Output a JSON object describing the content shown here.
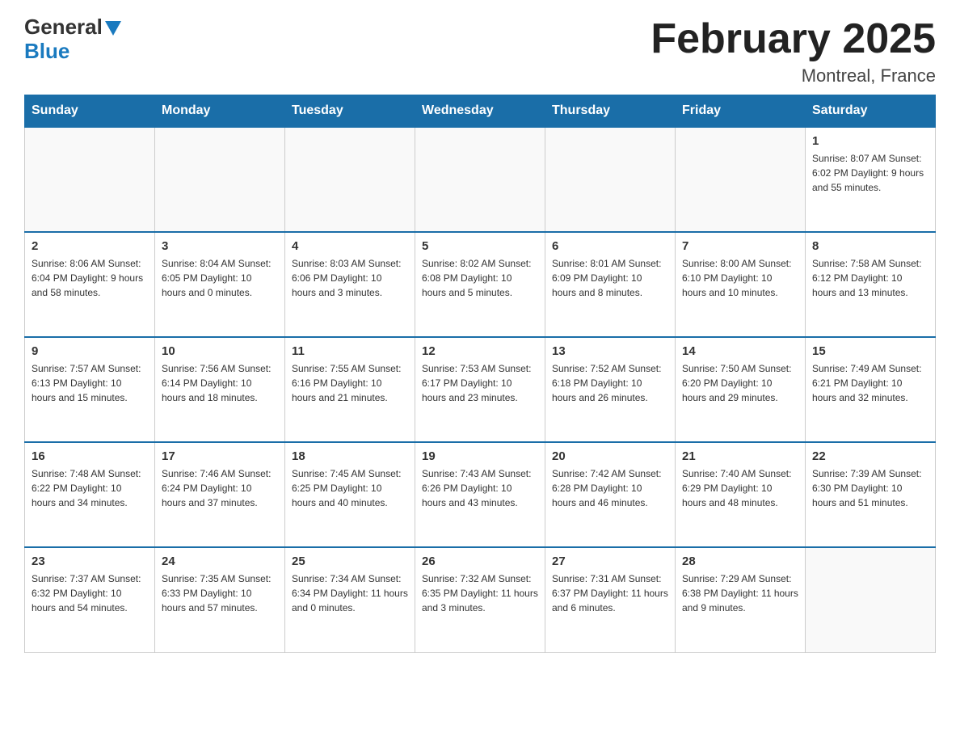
{
  "logo": {
    "text_general": "General",
    "text_blue": "Blue"
  },
  "header": {
    "title": "February 2025",
    "location": "Montreal, France"
  },
  "days_of_week": [
    "Sunday",
    "Monday",
    "Tuesday",
    "Wednesday",
    "Thursday",
    "Friday",
    "Saturday"
  ],
  "weeks": [
    [
      {
        "day": "",
        "info": ""
      },
      {
        "day": "",
        "info": ""
      },
      {
        "day": "",
        "info": ""
      },
      {
        "day": "",
        "info": ""
      },
      {
        "day": "",
        "info": ""
      },
      {
        "day": "",
        "info": ""
      },
      {
        "day": "1",
        "info": "Sunrise: 8:07 AM\nSunset: 6:02 PM\nDaylight: 9 hours and 55 minutes."
      }
    ],
    [
      {
        "day": "2",
        "info": "Sunrise: 8:06 AM\nSunset: 6:04 PM\nDaylight: 9 hours and 58 minutes."
      },
      {
        "day": "3",
        "info": "Sunrise: 8:04 AM\nSunset: 6:05 PM\nDaylight: 10 hours and 0 minutes."
      },
      {
        "day": "4",
        "info": "Sunrise: 8:03 AM\nSunset: 6:06 PM\nDaylight: 10 hours and 3 minutes."
      },
      {
        "day": "5",
        "info": "Sunrise: 8:02 AM\nSunset: 6:08 PM\nDaylight: 10 hours and 5 minutes."
      },
      {
        "day": "6",
        "info": "Sunrise: 8:01 AM\nSunset: 6:09 PM\nDaylight: 10 hours and 8 minutes."
      },
      {
        "day": "7",
        "info": "Sunrise: 8:00 AM\nSunset: 6:10 PM\nDaylight: 10 hours and 10 minutes."
      },
      {
        "day": "8",
        "info": "Sunrise: 7:58 AM\nSunset: 6:12 PM\nDaylight: 10 hours and 13 minutes."
      }
    ],
    [
      {
        "day": "9",
        "info": "Sunrise: 7:57 AM\nSunset: 6:13 PM\nDaylight: 10 hours and 15 minutes."
      },
      {
        "day": "10",
        "info": "Sunrise: 7:56 AM\nSunset: 6:14 PM\nDaylight: 10 hours and 18 minutes."
      },
      {
        "day": "11",
        "info": "Sunrise: 7:55 AM\nSunset: 6:16 PM\nDaylight: 10 hours and 21 minutes."
      },
      {
        "day": "12",
        "info": "Sunrise: 7:53 AM\nSunset: 6:17 PM\nDaylight: 10 hours and 23 minutes."
      },
      {
        "day": "13",
        "info": "Sunrise: 7:52 AM\nSunset: 6:18 PM\nDaylight: 10 hours and 26 minutes."
      },
      {
        "day": "14",
        "info": "Sunrise: 7:50 AM\nSunset: 6:20 PM\nDaylight: 10 hours and 29 minutes."
      },
      {
        "day": "15",
        "info": "Sunrise: 7:49 AM\nSunset: 6:21 PM\nDaylight: 10 hours and 32 minutes."
      }
    ],
    [
      {
        "day": "16",
        "info": "Sunrise: 7:48 AM\nSunset: 6:22 PM\nDaylight: 10 hours and 34 minutes."
      },
      {
        "day": "17",
        "info": "Sunrise: 7:46 AM\nSunset: 6:24 PM\nDaylight: 10 hours and 37 minutes."
      },
      {
        "day": "18",
        "info": "Sunrise: 7:45 AM\nSunset: 6:25 PM\nDaylight: 10 hours and 40 minutes."
      },
      {
        "day": "19",
        "info": "Sunrise: 7:43 AM\nSunset: 6:26 PM\nDaylight: 10 hours and 43 minutes."
      },
      {
        "day": "20",
        "info": "Sunrise: 7:42 AM\nSunset: 6:28 PM\nDaylight: 10 hours and 46 minutes."
      },
      {
        "day": "21",
        "info": "Sunrise: 7:40 AM\nSunset: 6:29 PM\nDaylight: 10 hours and 48 minutes."
      },
      {
        "day": "22",
        "info": "Sunrise: 7:39 AM\nSunset: 6:30 PM\nDaylight: 10 hours and 51 minutes."
      }
    ],
    [
      {
        "day": "23",
        "info": "Sunrise: 7:37 AM\nSunset: 6:32 PM\nDaylight: 10 hours and 54 minutes."
      },
      {
        "day": "24",
        "info": "Sunrise: 7:35 AM\nSunset: 6:33 PM\nDaylight: 10 hours and 57 minutes."
      },
      {
        "day": "25",
        "info": "Sunrise: 7:34 AM\nSunset: 6:34 PM\nDaylight: 11 hours and 0 minutes."
      },
      {
        "day": "26",
        "info": "Sunrise: 7:32 AM\nSunset: 6:35 PM\nDaylight: 11 hours and 3 minutes."
      },
      {
        "day": "27",
        "info": "Sunrise: 7:31 AM\nSunset: 6:37 PM\nDaylight: 11 hours and 6 minutes."
      },
      {
        "day": "28",
        "info": "Sunrise: 7:29 AM\nSunset: 6:38 PM\nDaylight: 11 hours and 9 minutes."
      },
      {
        "day": "",
        "info": ""
      }
    ]
  ]
}
